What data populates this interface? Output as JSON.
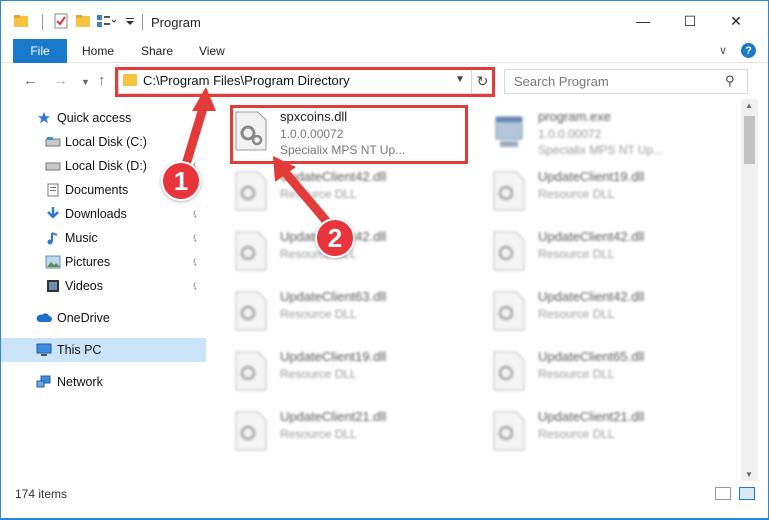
{
  "window": {
    "title": "Program",
    "minimize": "—",
    "maximize": "☐",
    "close": "✕"
  },
  "ribbon": {
    "tabs": [
      "File",
      "Home",
      "Share",
      "View"
    ],
    "help": "?"
  },
  "address": {
    "path": "C:\\Program Files\\Program Directory",
    "search_placeholder": "Search Program"
  },
  "sidebar": {
    "items": [
      {
        "label": "Quick access",
        "icon": "star-icon"
      },
      {
        "label": "Local Disk (C:)",
        "icon": "drive-icon",
        "pinned": true
      },
      {
        "label": "Local Disk (D:)",
        "icon": "drive-icon",
        "pinned": true
      },
      {
        "label": "Documents",
        "icon": "documents-icon",
        "pinned": true
      },
      {
        "label": "Downloads",
        "icon": "download-icon",
        "pinned": true
      },
      {
        "label": "Music",
        "icon": "music-icon",
        "pinned": true
      },
      {
        "label": "Pictures",
        "icon": "pictures-icon",
        "pinned": true
      },
      {
        "label": "Videos",
        "icon": "videos-icon",
        "pinned": true
      },
      {
        "label": "OneDrive",
        "icon": "cloud-icon"
      },
      {
        "label": "This PC",
        "icon": "computer-icon",
        "selected": true
      },
      {
        "label": "Network",
        "icon": "network-icon"
      }
    ]
  },
  "files": [
    {
      "name": "spxcoins.dll",
      "line1": "1.0.0.00072",
      "line2": "Specialix MPS NT Up...",
      "highlighted": true
    },
    {
      "name": "program.exe",
      "line1": "1.0.0.00072",
      "line2": "Specialix MPS NT Up..."
    },
    {
      "name": "UpdateClient42.dll",
      "line1": "Resource DLL",
      "line2": ""
    },
    {
      "name": "UpdateClient19.dll",
      "line1": "Resource DLL",
      "line2": ""
    },
    {
      "name": "UpdateClient42.dll",
      "line1": "Resource DLL",
      "line2": ""
    },
    {
      "name": "UpdateClient42.dll",
      "line1": "Resource DLL",
      "line2": ""
    },
    {
      "name": "UpdateClient63.dll",
      "line1": "Resource DLL",
      "line2": ""
    },
    {
      "name": "UpdateClient42.dll",
      "line1": "Resource DLL",
      "line2": ""
    },
    {
      "name": "UpdateClient19.dll",
      "line1": "Resource DLL",
      "line2": ""
    },
    {
      "name": "UpdateClient65.dll",
      "line1": "Resource DLL",
      "line2": ""
    },
    {
      "name": "UpdateClient21.dll",
      "line1": "Resource DLL",
      "line2": ""
    },
    {
      "name": "UpdateClient21.dll",
      "line1": "Resource DLL",
      "line2": ""
    }
  ],
  "status": {
    "count": "174 items"
  },
  "annotations": {
    "badge1": "1",
    "badge2": "2",
    "color": "#e33a3a"
  }
}
